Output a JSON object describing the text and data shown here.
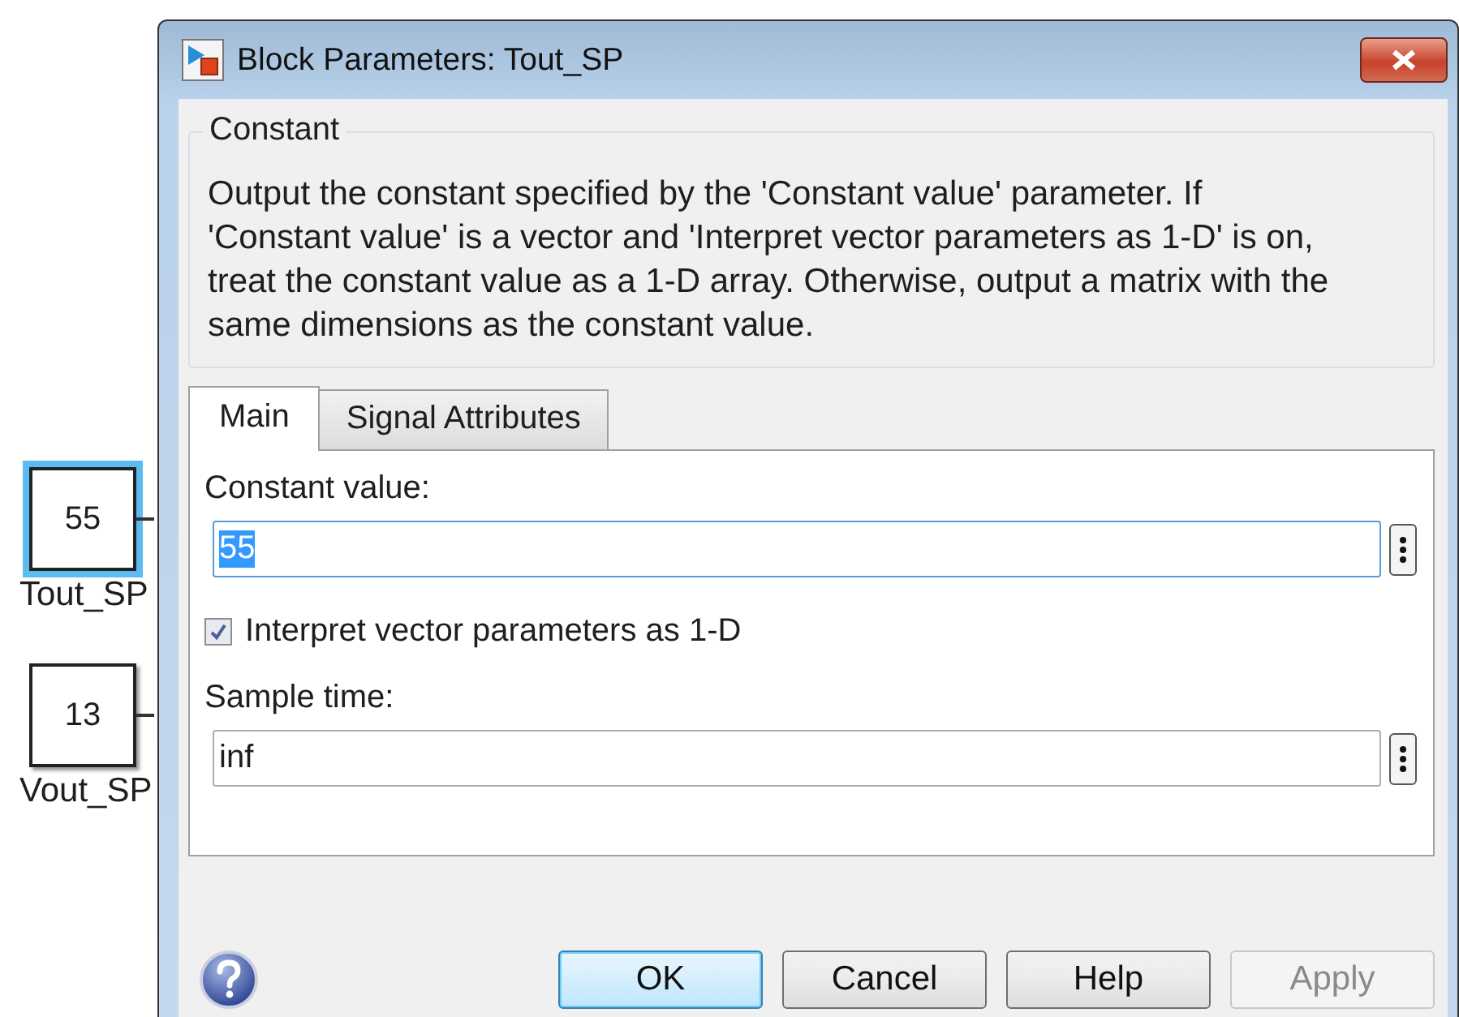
{
  "canvas": {
    "blocks": [
      {
        "value": "55",
        "label": "Tout_SP",
        "selected": true
      },
      {
        "value": "13",
        "label": "Vout_SP",
        "selected": false
      }
    ]
  },
  "dialog": {
    "title": "Block Parameters: Tout_SP",
    "group": {
      "title": "Constant",
      "description": "Output the constant specified by the 'Constant value' parameter. If 'Constant value' is a vector and 'Interpret vector parameters as 1-D' is on, treat the constant value as a 1-D array. Otherwise, output a matrix with the same dimensions as the constant value."
    },
    "tabs": [
      {
        "label": "Main",
        "selected": true
      },
      {
        "label": "Signal Attributes",
        "selected": false
      }
    ],
    "parameters": [
      {
        "kind": "field",
        "label": "Constant value:",
        "value": "55",
        "text_selected": true
      },
      {
        "kind": "checkbox",
        "label": "Interpret vector parameters as 1-D",
        "checked": true
      },
      {
        "kind": "field",
        "label": "Sample time:",
        "value": "inf",
        "text_selected": false
      }
    ],
    "buttons": [
      {
        "label": "OK",
        "default": true,
        "disabled": false
      },
      {
        "label": "Cancel",
        "default": false,
        "disabled": false
      },
      {
        "label": "Help",
        "default": false,
        "disabled": false
      },
      {
        "label": "Apply",
        "default": false,
        "disabled": true
      }
    ]
  }
}
